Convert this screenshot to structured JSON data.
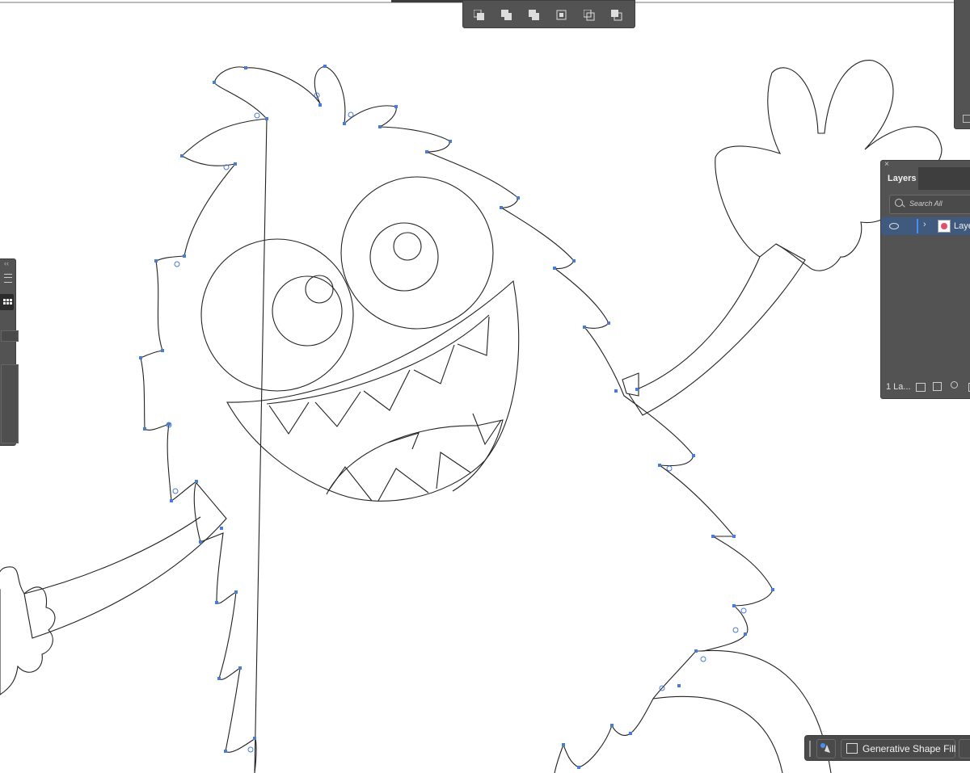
{
  "layers_panel": {
    "title": "Layers",
    "search_placeholder": "Search All",
    "layer_name": "Layer",
    "footer_count": "1 La..."
  },
  "pathfinder_toolbar": {
    "buttons": [
      "unite-icon",
      "minus-front-icon",
      "intersect-icon",
      "exclude-icon",
      "divide-icon",
      "trim-icon"
    ]
  },
  "contextual_bar": {
    "generative_label": "Generative Shape Fill"
  },
  "colors": {
    "panel": "#535353",
    "panel_dark": "#3c3c3c",
    "anchor": "#4a7bd6",
    "stroke": "#222222"
  }
}
